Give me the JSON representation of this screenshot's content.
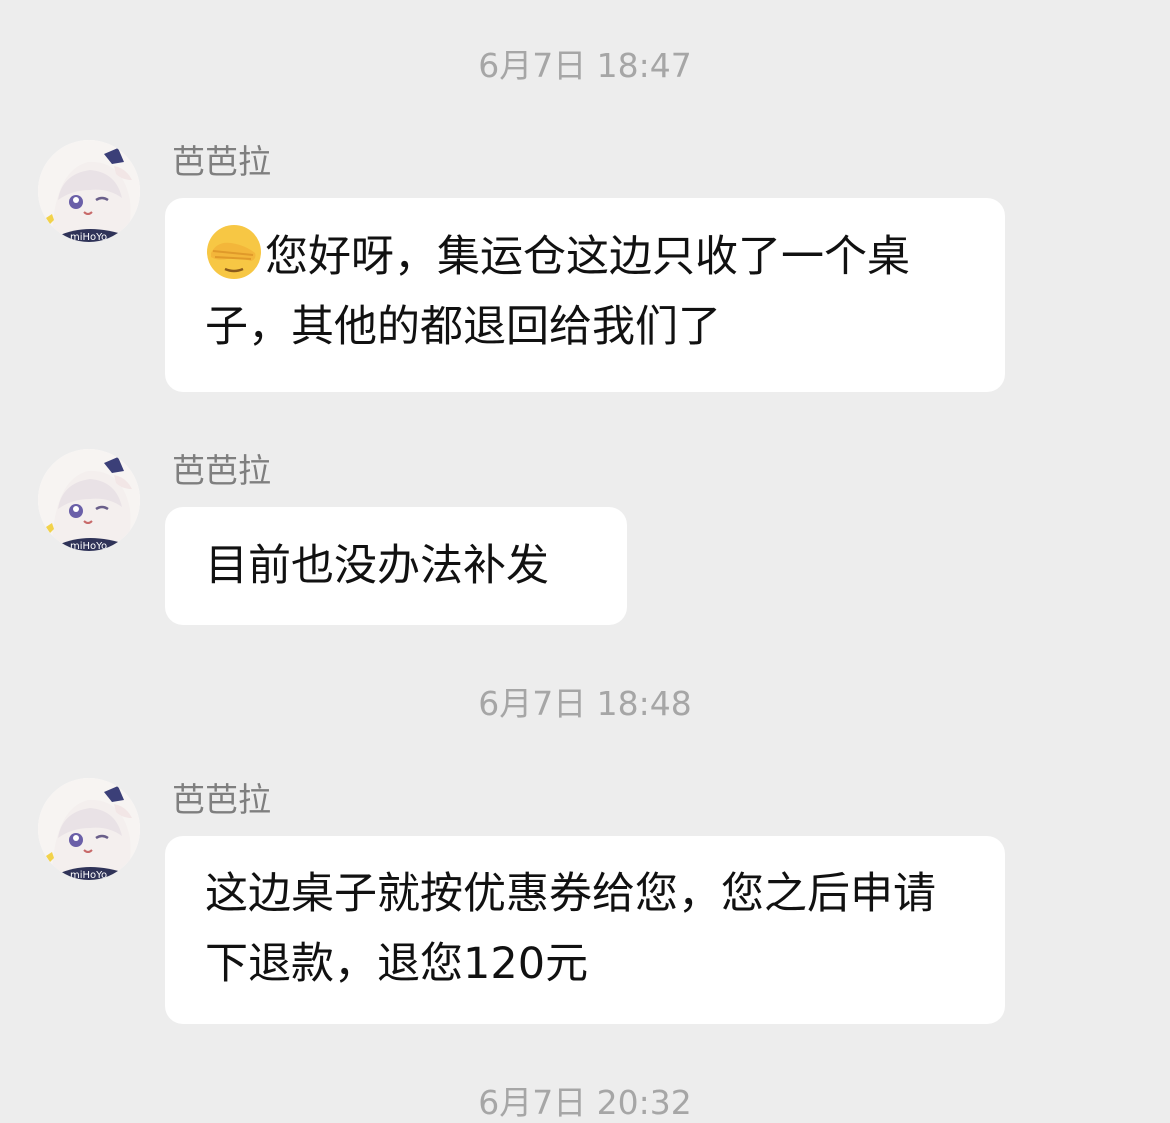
{
  "timestamps": [
    "6月7日 18:47",
    "6月7日 18:48",
    "6月7日 20:32"
  ],
  "messages": [
    {
      "sender": "芭芭拉",
      "emoji": "facepalm-emoji",
      "text": "您好呀，集运仓这边只收了一个桌子，其他的都退回给我们了"
    },
    {
      "sender": "芭芭拉",
      "text": "目前也没办法补发"
    },
    {
      "sender": "芭芭拉",
      "text": "这边桌子就按优惠券给您，您之后申请下退款，退您120元"
    }
  ],
  "avatar": {
    "icon": "paimon-avatar-icon",
    "watermark": "miHoYo"
  },
  "colors": {
    "background": "#ededed",
    "bubble": "#ffffff",
    "timestamp": "#a6a6a6",
    "sender": "#7f7f7f",
    "text": "#111111"
  }
}
